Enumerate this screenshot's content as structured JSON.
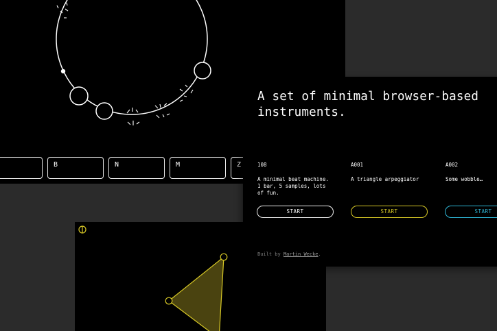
{
  "keyboard": {
    "keys": [
      "",
      "B",
      "N",
      "M",
      "Z"
    ]
  },
  "card": {
    "headline_line1": "A set of minimal browser-based",
    "headline_line2": "instruments.",
    "instruments": [
      {
        "id": "108",
        "desc_lines": [
          "A minimal beat machine.",
          "1 bar, 5 samples, lots",
          "of fun."
        ],
        "start_label": "START"
      },
      {
        "id": "A001",
        "desc_lines": [
          "A triangle arpeggiator"
        ],
        "start_label": "START"
      },
      {
        "id": "A002",
        "desc_lines": [
          "Some wobble…"
        ],
        "start_label": "START"
      }
    ],
    "footer_prefix": "Built by",
    "footer_author": "Martin Wecke",
    "footer_suffix": "."
  },
  "colors": {
    "background": "#2b2b2b",
    "panel": "#000000",
    "accent_white": "#ffffff",
    "accent_yellow": "#d8c926",
    "accent_blue": "#2fb8d8",
    "triangle_fill": "#4a4310"
  },
  "icons": {
    "power": "power-icon"
  }
}
